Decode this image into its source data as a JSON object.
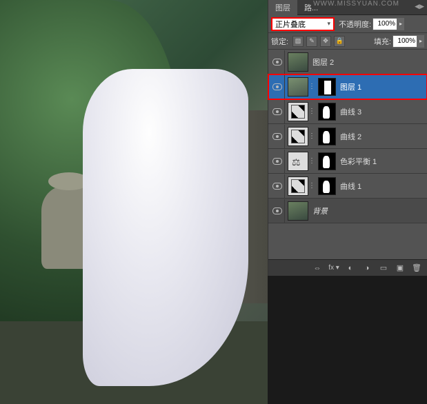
{
  "watermark": "WWW.MISSYUAN.COM",
  "tabs": {
    "layers": "图层",
    "paths": "路..."
  },
  "blend_mode": "正片叠底",
  "opacity": {
    "label": "不透明度:",
    "value": "100%"
  },
  "lock": {
    "label": "锁定:"
  },
  "fill": {
    "label": "填充:",
    "value": "100%"
  },
  "layers": [
    {
      "name": "图层 2",
      "type": "raster",
      "selected": false,
      "mask": false
    },
    {
      "name": "图层 1",
      "type": "raster",
      "selected": true,
      "mask": true,
      "highlight": true
    },
    {
      "name": "曲线 3",
      "type": "curves",
      "selected": false,
      "mask": true
    },
    {
      "name": "曲线 2",
      "type": "curves",
      "selected": false,
      "mask": true
    },
    {
      "name": "色彩平衡 1",
      "type": "colorbalance",
      "selected": false,
      "mask": true
    },
    {
      "name": "曲线 1",
      "type": "curves",
      "selected": false,
      "mask": true
    },
    {
      "name": "背景",
      "type": "background",
      "selected": false,
      "mask": false
    }
  ],
  "footer": {
    "link": "⇔",
    "fx": "fx ▾",
    "mask": "◐",
    "adj": "◑",
    "group": "▭",
    "new": "▣",
    "trash": "🗑"
  }
}
